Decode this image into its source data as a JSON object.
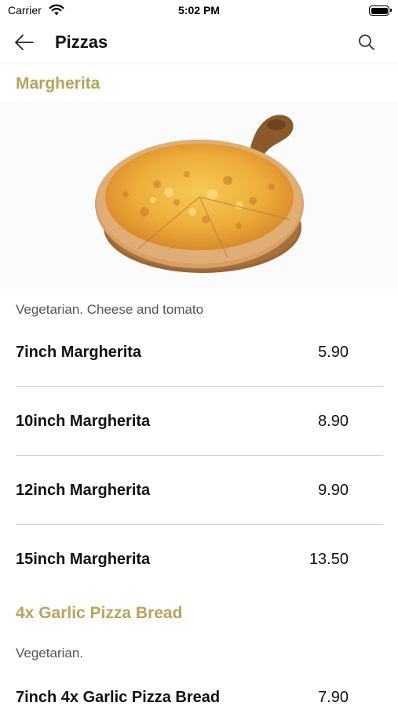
{
  "status": {
    "carrier": "Carrier",
    "time": "5:02 PM"
  },
  "nav": {
    "title": "Pizzas",
    "back_icon": "arrow-left-icon",
    "search_icon": "search-icon"
  },
  "colors": {
    "accent": "#b7a45c",
    "divider": "#d0d0d0"
  },
  "sections": [
    {
      "title": "Margherita",
      "description": "Vegetarian. Cheese and tomato",
      "items": [
        {
          "name": "7inch Margherita",
          "price": "5.90"
        },
        {
          "name": "10inch Margherita",
          "price": "8.90"
        },
        {
          "name": "12inch Margherita",
          "price": "9.90"
        },
        {
          "name": "15inch Margherita",
          "price": "13.50"
        }
      ]
    },
    {
      "title": "4x Garlic Pizza Bread",
      "description": "Vegetarian.",
      "items": [
        {
          "name": "7inch 4x Garlic Pizza Bread",
          "price": "7.90"
        }
      ]
    }
  ]
}
